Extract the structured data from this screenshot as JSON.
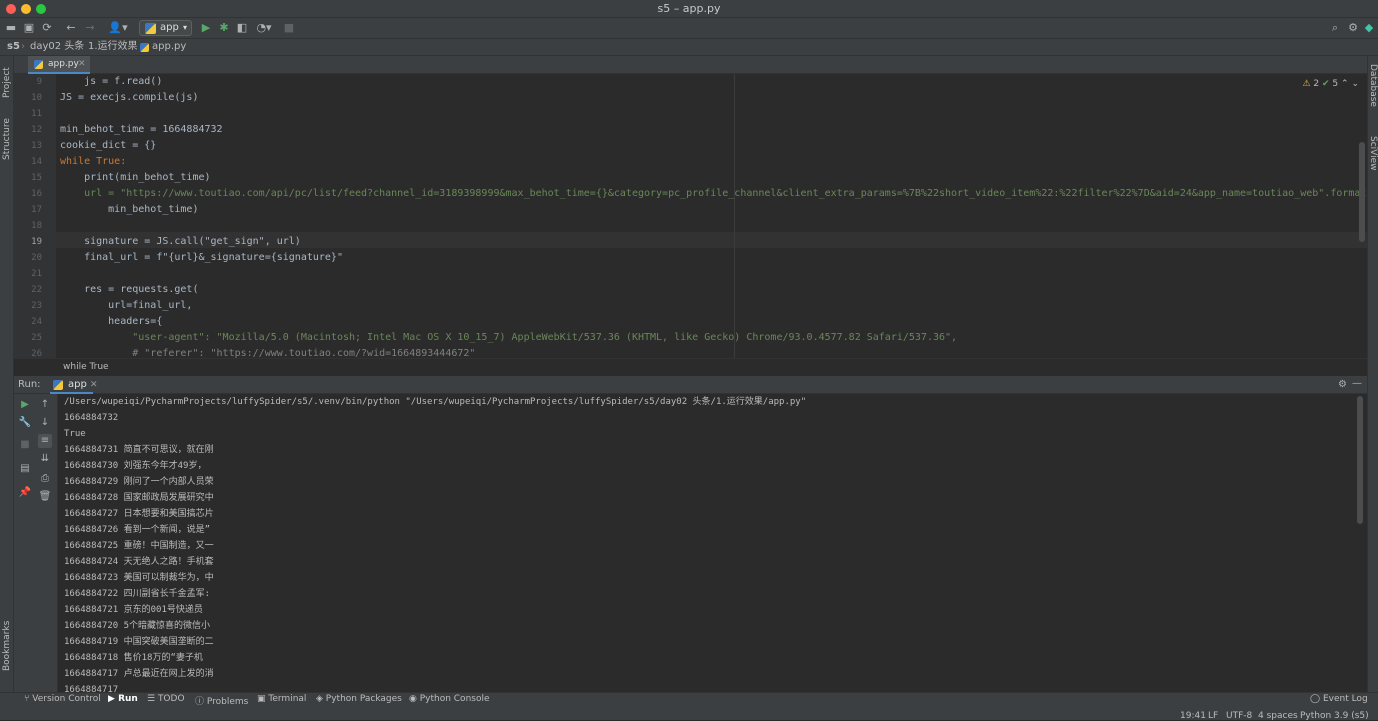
{
  "window": {
    "title": "s5 – app.py"
  },
  "toolbar": {
    "run_config": "app"
  },
  "breadcrumb": [
    "s5",
    "day02 头条",
    "1.运行效果",
    "app.py"
  ],
  "left_strip": [
    "Project",
    "Structure",
    "Bookmarks"
  ],
  "right_strip": [
    "Database",
    "SciView"
  ],
  "editor": {
    "tab": "app.py",
    "inspections": {
      "warnings": "2",
      "ok": "5"
    },
    "line_numbers": [
      "9",
      "10",
      "11",
      "12",
      "13",
      "14",
      "15",
      "16",
      "17",
      "18",
      "19",
      "20",
      "21",
      "22",
      "23",
      "24",
      "25",
      "26"
    ],
    "lines": [
      "    js = f.read()",
      "JS = execjs.compile(js)",
      "",
      "min_behot_time = 1664884732",
      "cookie_dict = {}",
      "while True:",
      "    print(min_behot_time)",
      "    url = \"https://www.toutiao.com/api/pc/list/feed?channel_id=3189398999&max_behot_time={}&category=pc_profile_channel&client_extra_params=%7B%22short_video_item%22:%22filter%22%7D&aid=24&app_name=toutiao_web\".format(",
      "        min_behot_time)",
      "",
      "    signature = JS.call(\"get_sign\", url)",
      "    final_url = f\"{url}&_signature={signature}\"",
      "",
      "    res = requests.get(",
      "        url=final_url,",
      "        headers={",
      "            \"user-agent\": \"Mozilla/5.0 (Macintosh; Intel Mac OS X 10_15_7) AppleWebKit/537.36 (KHTML, like Gecko) Chrome/93.0.4577.82 Safari/537.36\",",
      "            # \"referer\": \"https://www.toutiao.com/?wid=1664893444672\""
    ],
    "code_breadcrumb": "while True"
  },
  "run": {
    "label": "Run:",
    "tab": "app",
    "output": [
      "/Users/wupeiqi/PycharmProjects/luffySpider/s5/.venv/bin/python \"/Users/wupeiqi/PycharmProjects/luffySpider/s5/day02 头条/1.运行效果/app.py\"",
      "1664884732",
      "True",
      "1664884731 简直不可思议，就在刚",
      "1664884730 刘强东今年才49岁，",
      "1664884729 刚问了一个内部人员荣",
      "1664884728 国家邮政局发展研究中",
      "1664884727 日本想要和美国搞芯片",
      "1664884726 看到一个新闻，说是”",
      "1664884725 重磅！中国制造，又一",
      "1664884724 天无绝人之路！手机套",
      "1664884723 美国可以制裁华为，中",
      "1664884722 四川副省长千金孟军:",
      "1664884721 京东的001号快递员",
      "1664884720 5个暗藏惊喜的微信小",
      "1664884719 中国突破美国垄断的二",
      "1664884718 售价18万的“妻子机",
      "1664884717 卢总最近在网上发的消",
      "1664884717"
    ]
  },
  "status": {
    "tools": [
      "Version Control",
      "Run",
      "TODO",
      "Problems",
      "Terminal",
      "Python Packages",
      "Python Console"
    ],
    "event_log": "Event Log",
    "bottom": [
      "19:41",
      "LF",
      "UTF-8",
      "4 spaces",
      "Python 3.9 (s5)"
    ]
  }
}
